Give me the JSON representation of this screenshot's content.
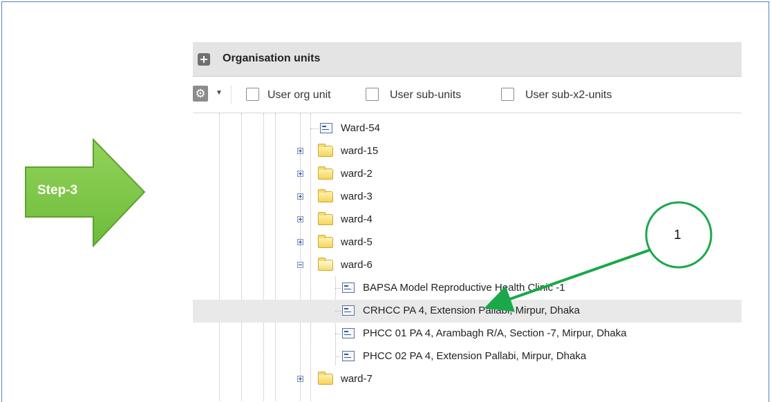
{
  "panel": {
    "title": "Organisation units",
    "header_icon": "plus-icon",
    "toolbar": {
      "settings_icon": "gear-icon",
      "checkboxes": [
        {
          "label": "User org unit",
          "checked": false
        },
        {
          "label": "User sub-units",
          "checked": false
        },
        {
          "label": "User sub-x2-units",
          "checked": false
        }
      ]
    }
  },
  "tree": {
    "nodes": [
      {
        "label": "Ward-54",
        "kind": "leaf"
      },
      {
        "label": "ward-15",
        "kind": "folder",
        "expanded": false
      },
      {
        "label": "ward-2",
        "kind": "folder",
        "expanded": false
      },
      {
        "label": "ward-3",
        "kind": "folder",
        "expanded": false
      },
      {
        "label": "ward-4",
        "kind": "folder",
        "expanded": false
      },
      {
        "label": "ward-5",
        "kind": "folder",
        "expanded": false
      },
      {
        "label": "ward-6",
        "kind": "folder",
        "expanded": true
      },
      {
        "label": "BAPSA Model Reproductive Health Clinic -1",
        "kind": "leaf"
      },
      {
        "label": "CRHCC PA 4, Extension Pallabi, Mirpur, Dhaka",
        "kind": "leaf",
        "selected": true
      },
      {
        "label": "PHCC 01 PA 4, Arambagh R/A, Section -7, Mirpur, Dhaka",
        "kind": "leaf"
      },
      {
        "label": "PHCC 02 PA 4, Extension Pallabi, Mirpur, Dhaka",
        "kind": "leaf"
      },
      {
        "label": "ward-7",
        "kind": "folder",
        "expanded": false
      }
    ]
  },
  "annotations": {
    "step_label": "Step-3",
    "callout_number": "1",
    "arrow_color": "#7ac143",
    "callout_color": "#1aa84a"
  }
}
